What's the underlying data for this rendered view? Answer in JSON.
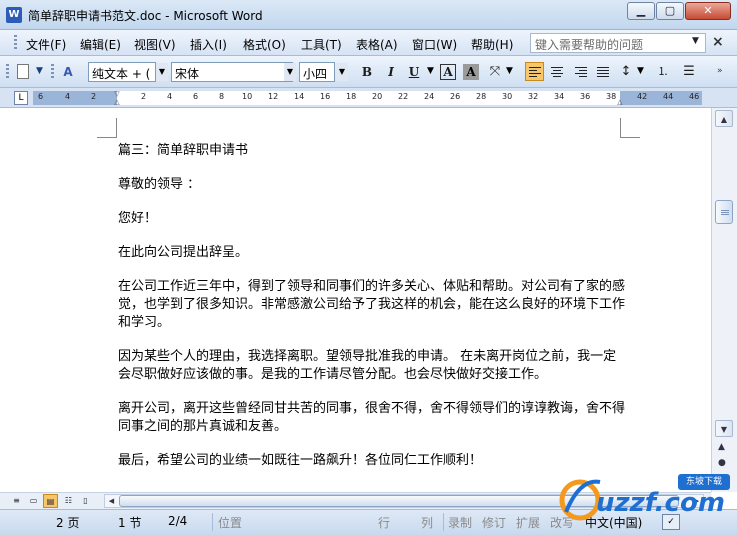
{
  "window": {
    "title": "简单辞职申请书范文.doc - Microsoft Word",
    "app_icon_letter": "W",
    "minimize_glyph": "▁",
    "maximize_glyph": "▢",
    "close_glyph": "✕"
  },
  "menu": {
    "items": [
      "文件(F)",
      "编辑(E)",
      "视图(V)",
      "插入(I)",
      "格式(O)",
      "工具(T)",
      "表格(A)",
      "窗口(W)",
      "帮助(H)"
    ],
    "help_placeholder": "键入需要帮助的问题",
    "doc_close_glyph": "×"
  },
  "toolbar": {
    "style_value": "纯文本 + (",
    "font_value": "宋体",
    "size_value": "小四",
    "bold": "B",
    "italic": "I",
    "underline": "U",
    "boxed_a": "A",
    "shaded_a": "A"
  },
  "ruler": {
    "ticks_left": [
      "6",
      "4",
      "2"
    ],
    "ticks_right": [
      "2",
      "4",
      "6",
      "8",
      "10",
      "12",
      "14",
      "16",
      "18",
      "20",
      "22",
      "24",
      "26",
      "28",
      "30",
      "32",
      "34",
      "36",
      "38"
    ],
    "ticks_far": [
      "42",
      "44",
      "46"
    ],
    "tab_glyph": "L"
  },
  "document": {
    "paragraphs": [
      "篇三：简单辞职申请书",
      "尊敬的领导 ：",
      "您好！",
      "在此向公司提出辞呈。",
      "在公司工作近三年中，得到了领导和同事们的许多关心、体贴和帮助。对公司有了家的感觉，也学到了很多知识。非常感激公司给予了我这样的机会，能在这么良好的环境下工作和学习。",
      "因为某些个人的理由，我选择离职。望领导批准我的申请。  在未离开岗位之前，我一定会尽职做好应该做的事。是我的工作请尽管分配。也会尽快做好交接工作。",
      "离开公司，离开这些曾经同甘共苦的同事，很舍不得，舍不得领导们的谆谆教诲，舍不得同事之间的那片真诚和友善。",
      "最后，希望公司的业绩一如既往一路飙升！各位同仁工作顺利！"
    ]
  },
  "status": {
    "page": "2 页",
    "section": "1 节",
    "page_of": "2/4",
    "position": "位置",
    "line": "行",
    "column": "列",
    "record": "录制",
    "revise": "修订",
    "extend": "扩展",
    "overtype": "改写",
    "language": "中文(中国)"
  },
  "watermark": {
    "brand": "uzzf.com",
    "tag": "东坡下载"
  },
  "colors": {
    "title_gradient_top": "#dbe8f6",
    "menu_bg": "#d6e3f4",
    "active_button": "#f8c66a",
    "watermark_blue": "#1f6fd1"
  }
}
